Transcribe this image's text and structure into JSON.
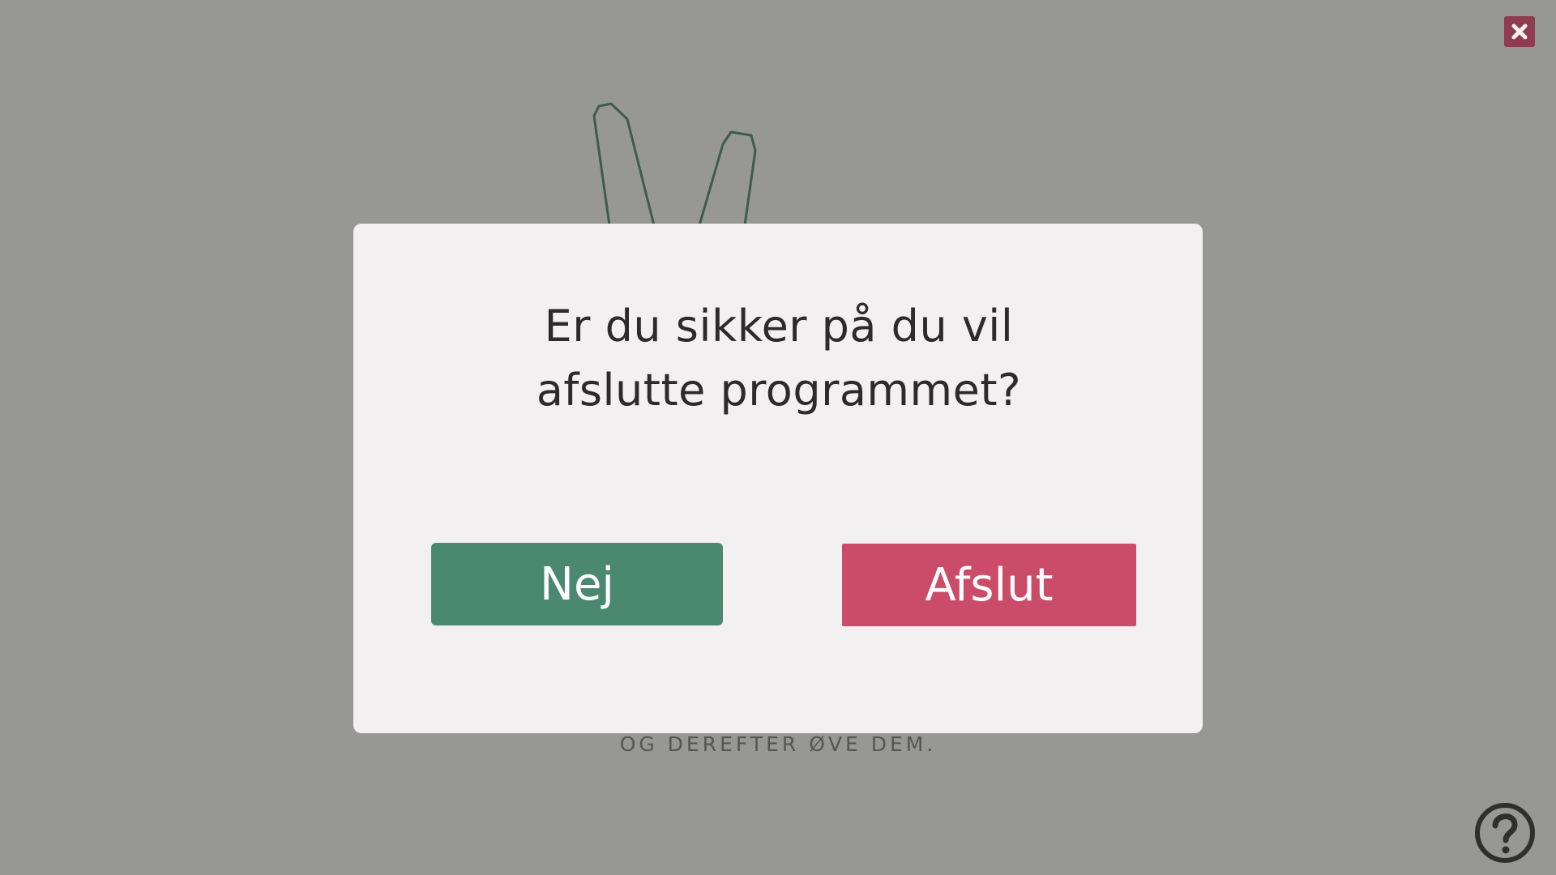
{
  "background": {
    "subtitle": "OG DEREFTER ØVE DEM."
  },
  "dialog": {
    "message_line1": "Er du sikker på du vil",
    "message_line2": "afslutte programmet?",
    "no_label": "Nej",
    "exit_label": "Afslut"
  },
  "icons": {
    "close": "close-icon",
    "help": "help-icon",
    "illustration": "hand-illustration"
  },
  "colors": {
    "backdrop": "#979796",
    "dialog_bg": "#f2f0f1",
    "no_button": "#4a8870",
    "exit_button": "#ca4c69",
    "close_button": "#8f3c51"
  }
}
